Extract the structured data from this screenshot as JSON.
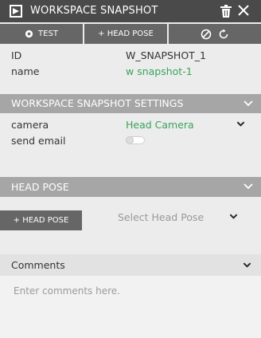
{
  "window": {
    "title": "WORKSPACE SNAPSHOT",
    "logo_icon": "workspace-logo-icon",
    "delete_icon": "trash-icon",
    "close_icon": "close-icon"
  },
  "toolbar": {
    "test_label": "TEST",
    "test_icon": "gear-icon",
    "head_pose_label": "+ HEAD POSE",
    "disable_icon": "disable-icon",
    "reset_icon": "reset-icon"
  },
  "properties": {
    "id_label": "ID",
    "id_value": "W_SNAPSHOT_1",
    "name_label": "name",
    "name_value": "w snapshot-1"
  },
  "settings": {
    "title": "WORKSPACE SNAPSHOT SETTINGS",
    "camera_label": "camera",
    "camera_value": "Head Camera",
    "send_email_label": "send email",
    "send_email_on": false
  },
  "head_pose": {
    "title": "HEAD POSE",
    "add_label": "+ HEAD POSE",
    "select_placeholder": "Select Head Pose"
  },
  "comments": {
    "title": "Comments",
    "placeholder": "Enter comments here."
  },
  "colors": {
    "titlebar": "#4a4a4a",
    "button": "#666666",
    "section": "#a6a6a6",
    "accent_green": "#3aa35a"
  }
}
